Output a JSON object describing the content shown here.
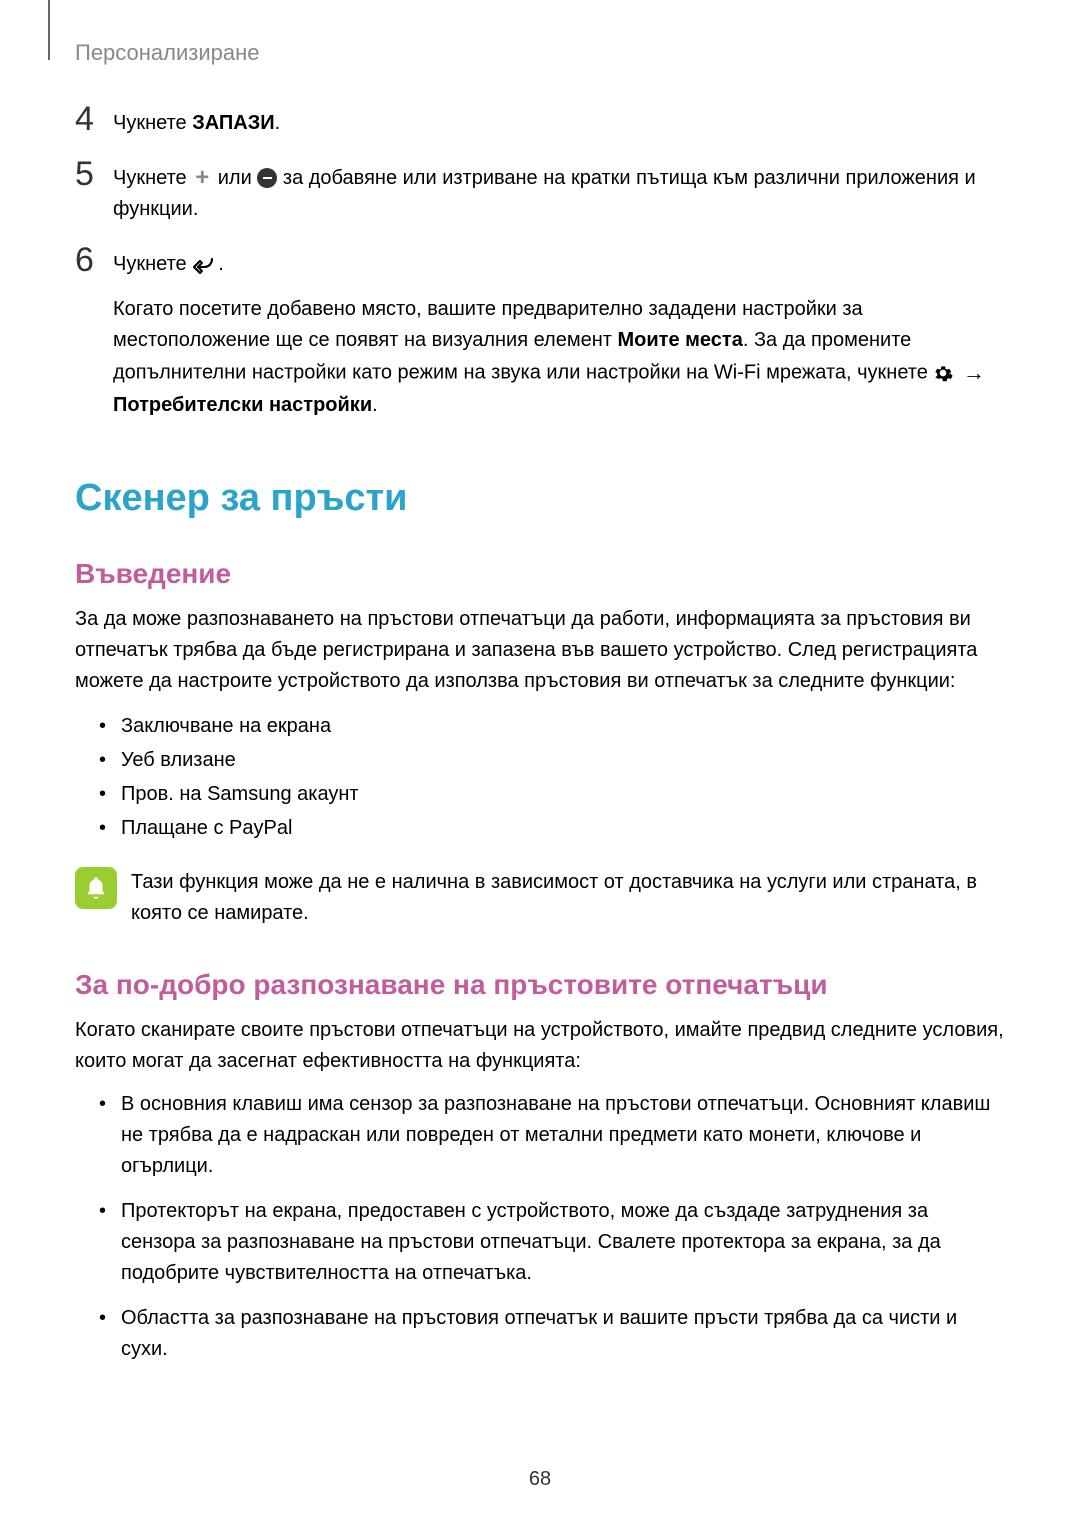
{
  "header": "Персонализиране",
  "steps": [
    {
      "num": "4",
      "prefix": "Чукнете ",
      "bold": "ЗАПАЗИ",
      "suffix": "."
    },
    {
      "num": "5",
      "part1": "Чукнете ",
      "mid": " или ",
      "part2": " за добавяне или изтриване на кратки пътища към различни приложения и функции."
    },
    {
      "num": "6",
      "prefix": "Чукнете ",
      "suffix": ".",
      "p2_a": "Когато посетите добавено място, вашите предварително зададени настройки за местоположение ще се появят на визуалния елемент ",
      "p2_bold1": "Моите места",
      "p2_b": ". За да промените допълнителни настройки като режим на звука или настройки на Wi-Fi мрежата, чукнете ",
      "arrow": "→",
      "p2_bold2": "Потребителски настройки",
      "p2_end": "."
    }
  ],
  "h1": "Скенер за пръсти",
  "intro": {
    "heading": "Въведение",
    "body": "За да може разпознаването на пръстови отпечатъци да работи, информацията за пръстовия ви отпечатък трябва да бъде регистрирана и запазена във вашето устройство. След регистрацията можете да настроите устройството да използва пръстовия ви отпечатък за следните функции:",
    "bullets": [
      "Заключване на екрана",
      "Уеб влизане",
      "Пров. на Samsung акаунт",
      "Плащане с PayPal"
    ],
    "note": "Тази функция може да не е налична в зависимост от доставчика на услуги или страната, в която се намирате."
  },
  "recognition": {
    "heading": "За по-добро разпознаване на пръстовите отпечатъци",
    "body": "Когато сканирате своите пръстови отпечатъци на устройството, имайте предвид следните условия, които могат да засегнат ефективността на функцията:",
    "bullets": [
      "В основния клавиш има сензор за разпознаване на пръстови отпечатъци. Основният клавиш не трябва да е надраскан или повреден от метални предмети като монети, ключове и огърлици.",
      "Протекторът на екрана, предоставен с устройството, може да създаде затруднения за сензора за разпознаване на пръстови отпечатъци. Свалете протектора за екрана, за да подобрите чувствителността на отпечатъка.",
      "Областта за разпознаване на пръстовия отпечатък и вашите пръсти трябва да са чисти и сухи."
    ]
  },
  "pageNumber": "68"
}
